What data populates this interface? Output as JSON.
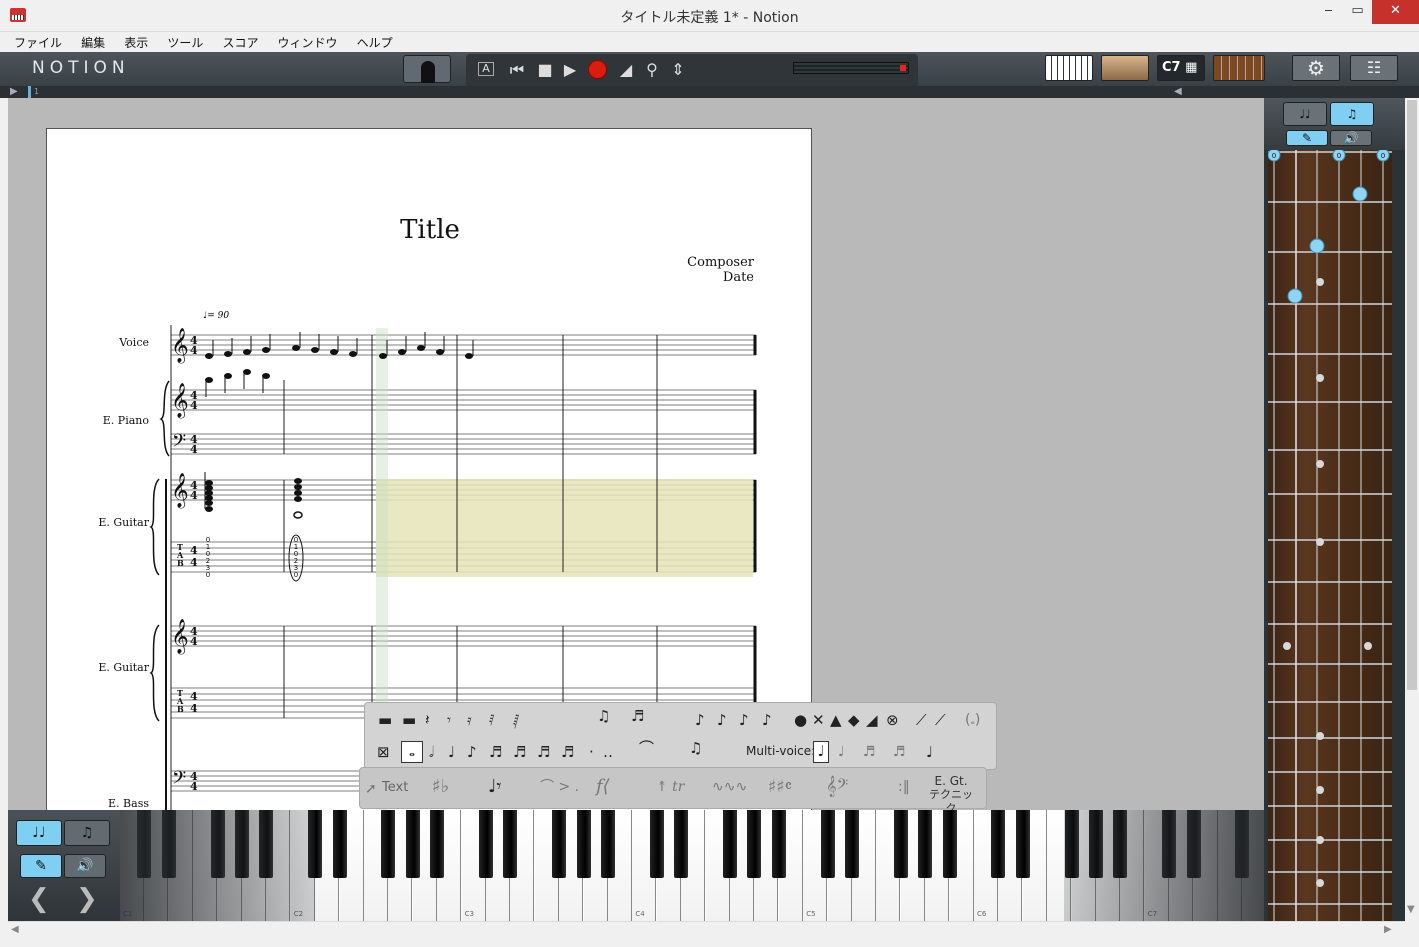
{
  "window": {
    "title": "タイトル未定義 1* - Notion",
    "minimize": "‒",
    "maximize": "▭",
    "close": "✕"
  },
  "menu": [
    "ファイル",
    "編集",
    "表示",
    "ツール",
    "スコア",
    "ウィンドウ",
    "ヘルプ"
  ],
  "toolbar": {
    "logo": "NOTION",
    "chord_label": "C7",
    "meter_level": 0.95
  },
  "ruler": {
    "measure": "1"
  },
  "score": {
    "title": "Title",
    "composer": "Composer",
    "date": "Date",
    "tempo": "♩= 90",
    "instruments": [
      "Voice",
      "E. Piano",
      "E. Guitar",
      "E. Guitar",
      "E. Bass"
    ],
    "tab_letters": "T\nA\nB",
    "tab_fingering": "0\n1\n0\n2\n3\n0"
  },
  "entry_palette": {
    "multivoice_label": "Multi-voice:",
    "text_button": "Text",
    "technique_line1": "E. Gt.",
    "technique_line2": "テクニック"
  },
  "keyboard": {
    "octave_labels": [
      "C1",
      "C2",
      "C3",
      "C4",
      "C5",
      "C6",
      "C7"
    ]
  },
  "fretboard": {
    "open_string_markers": [
      "0",
      "0",
      "0"
    ]
  }
}
